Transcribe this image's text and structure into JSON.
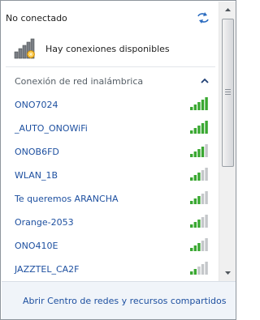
{
  "status": {
    "text": "No conectado",
    "refresh_icon": "refresh-arrows-icon"
  },
  "available": {
    "text": "Hay conexiones disponibles",
    "icon": "wifi-available-icon"
  },
  "section": {
    "title": "Conexión de red inalámbrica",
    "collapse_icon": "chevron-up-icon"
  },
  "networks": [
    {
      "name": "ONO7024",
      "signal": 5
    },
    {
      "name": "_AUTO_ONOWiFi",
      "signal": 5
    },
    {
      "name": "ONOB6FD",
      "signal": 4
    },
    {
      "name": "WLAN_1B",
      "signal": 3
    },
    {
      "name": "Te queremos ARANCHA",
      "signal": 3
    },
    {
      "name": "Orange-2053",
      "signal": 3
    },
    {
      "name": "ONO410E",
      "signal": 3
    },
    {
      "name": "JAZZTEL_CA2F",
      "signal": 2
    }
  ],
  "footer": {
    "link": "Abrir Centro de redes y recursos compartidos"
  },
  "colors": {
    "signal_on": "#3aa832",
    "signal_off": "#c4c7ca",
    "link": "#1e50a0"
  }
}
